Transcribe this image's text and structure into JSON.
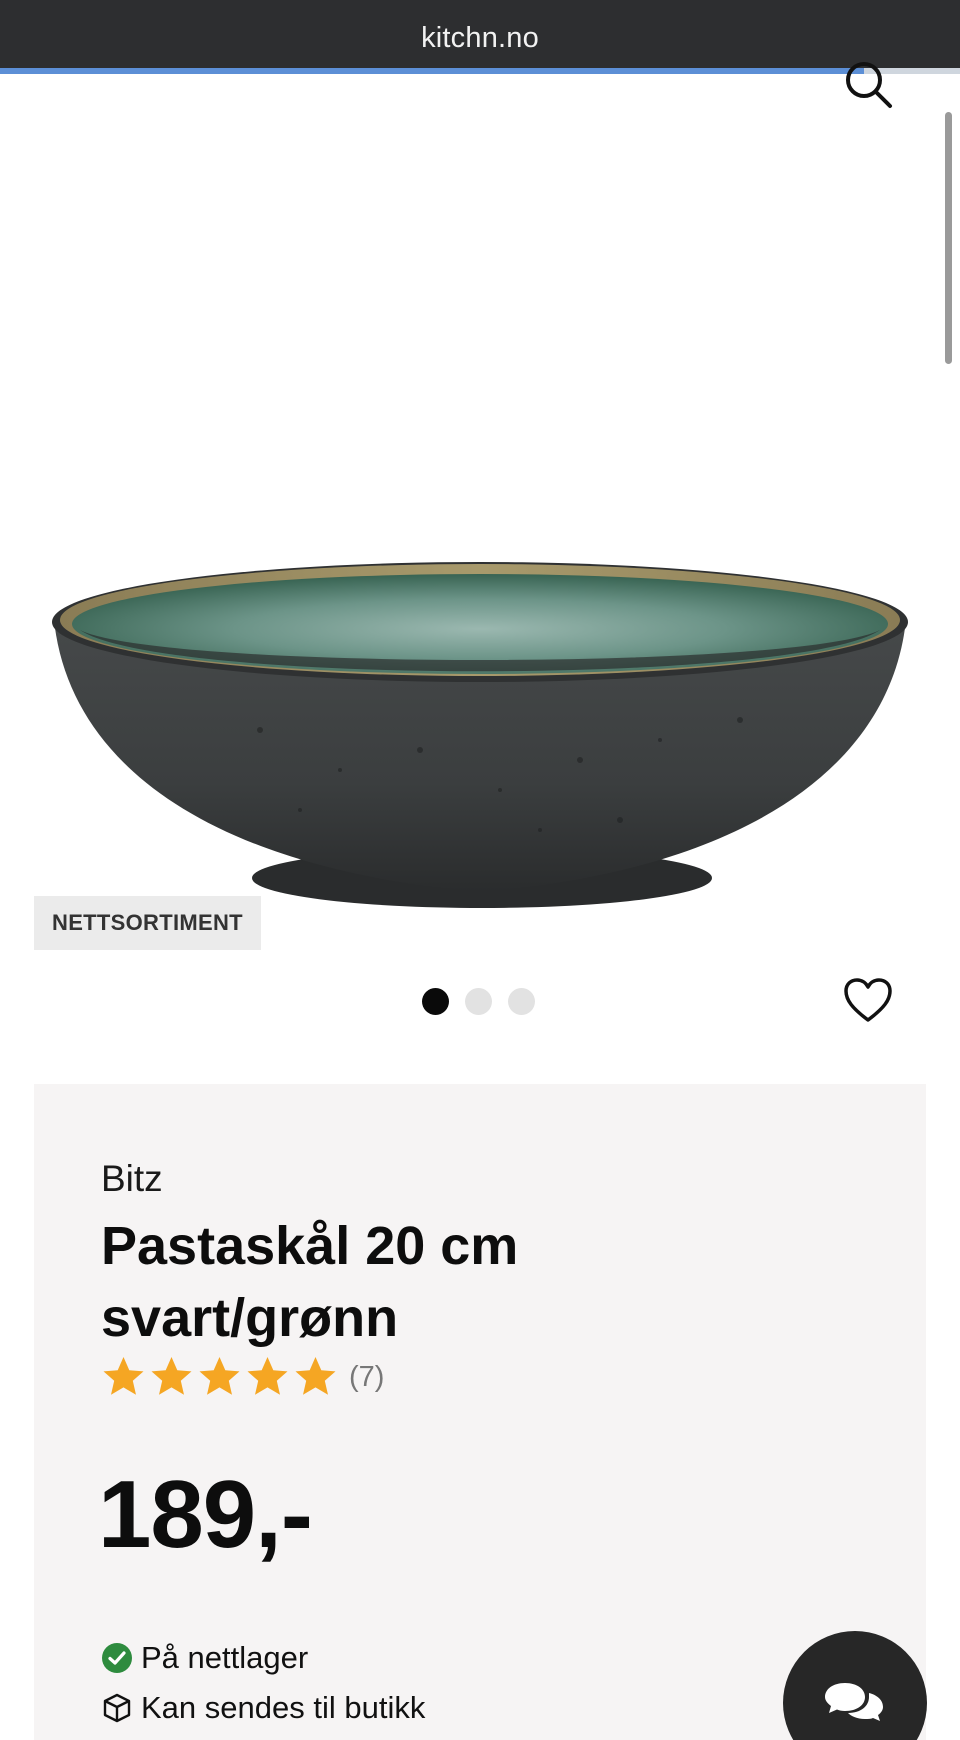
{
  "browser": {
    "url": "kitchn.no",
    "load_progress": 0.9
  },
  "product": {
    "badge": "NETTSORTIMENT",
    "image_count": 3,
    "active_image": 1,
    "brand": "Bitz",
    "title": "Pastaskål 20 cm svart/grønn",
    "rating": 5,
    "rating_count": "(7)",
    "price": "189,-",
    "stock_status": "På nettlager",
    "shipping_status": "Kan sendes til butikk"
  },
  "icons": {
    "search": "search-icon",
    "favorite": "heart-icon",
    "stock": "check-circle-icon",
    "shipping": "box-icon",
    "chat": "chat-bubbles-icon"
  },
  "colors": {
    "star": "#f5a623",
    "stock_ok": "#2e8b3e",
    "chat_bg": "#272727"
  }
}
